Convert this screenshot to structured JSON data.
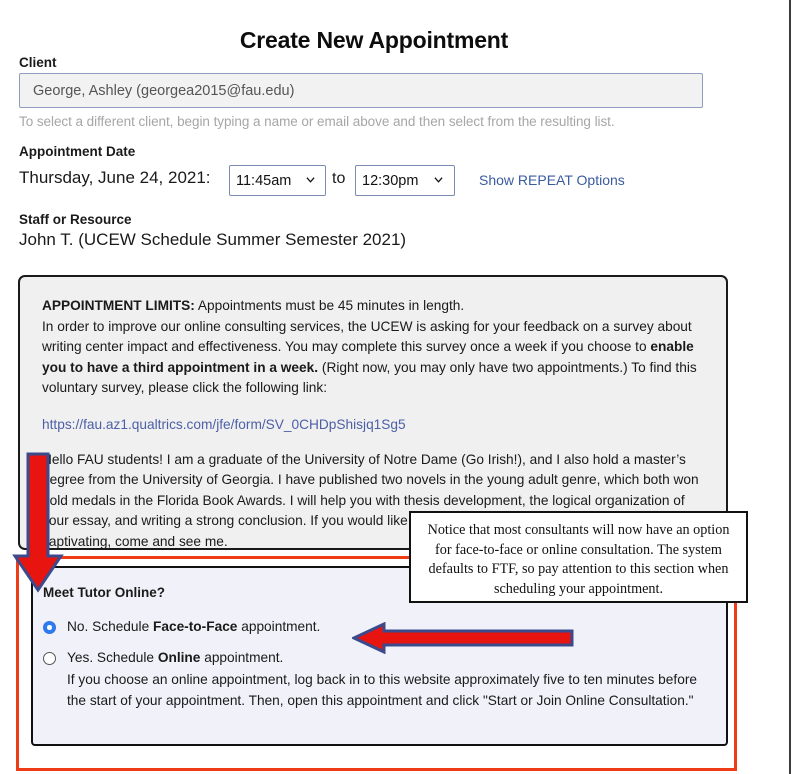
{
  "page": {
    "title": "Create New Appointment"
  },
  "client": {
    "label": "Client",
    "value": "George, Ashley (georgea2015@fau.edu)",
    "placeholder": "George, Ashley (georgea2015@fau.edu)",
    "hint": "To select a different client, begin typing a name or email above and then select from the resulting list."
  },
  "appointment_date": {
    "label": "Appointment Date",
    "date_text": "Thursday, June 24, 2021:",
    "start_time": "11:45am",
    "to_word": "to",
    "end_time": "12:30pm",
    "start_options": [
      "11:45am"
    ],
    "end_options": [
      "12:30pm"
    ],
    "repeat_link": "Show REPEAT Options"
  },
  "staff": {
    "label": "Staff or Resource",
    "value": "John T. (UCEW Schedule Summer Semester 2021)"
  },
  "notes": {
    "limits_heading": "APPOINTMENT LIMITS:",
    "limits_text": " Appointments must be 45 minutes in length.",
    "survey_pre": "In order to improve our online consulting services, the UCEW is asking for your feedback on a survey about writing center impact and effectiveness. You may complete this survey once a week if you choose to ",
    "survey_bold": "enable you to have a third appointment in a week.",
    "survey_post": " (Right now, you may only have two appointments.) To find this voluntary survey, please click the following link:",
    "survey_link": "https://fau.az1.qualtrics.com/jfe/form/SV_0CHDpShisjq1Sg5",
    "bio": "Hello FAU students! I am a graduate of the University of Notre Dame (Go Irish!), and I also hold a master’s degree from the University of Georgia. I have published two novels in the young adult genre, which both won gold medals in the Florida Book Awards. I will help you with thesis development, the logical organization of your essay, and writing a strong conclusion. If you would like help in making your prose concise, cogent, and captivating, come and see me."
  },
  "meet_online": {
    "heading": "Meet Tutor Online?",
    "option_ftf": {
      "pre": "No. Schedule ",
      "bold": "Face-to-Face",
      "post": " appointment.",
      "selected": true
    },
    "option_online": {
      "pre": "Yes. Schedule ",
      "bold": "Online",
      "post": " appointment.",
      "selected": false
    },
    "online_description": "If you choose an online appointment, log back in to this website approximately five to ten minutes before the start of your appointment. Then, open this appointment and click \"Start or Join Online Consultation.\""
  },
  "callout": {
    "text": "Notice that most consultants will now have an option for face-to-face or online consultation. The system defaults to FTF, so pay attention to this section when scheduling your appointment."
  },
  "annotation_colors": {
    "arrow_fill": "#e8140f",
    "arrow_outline": "#3b4a8c",
    "highlight_box": "#ef3b16",
    "link": "#3a5ba0",
    "radio_selected": "#2b7cf0"
  }
}
